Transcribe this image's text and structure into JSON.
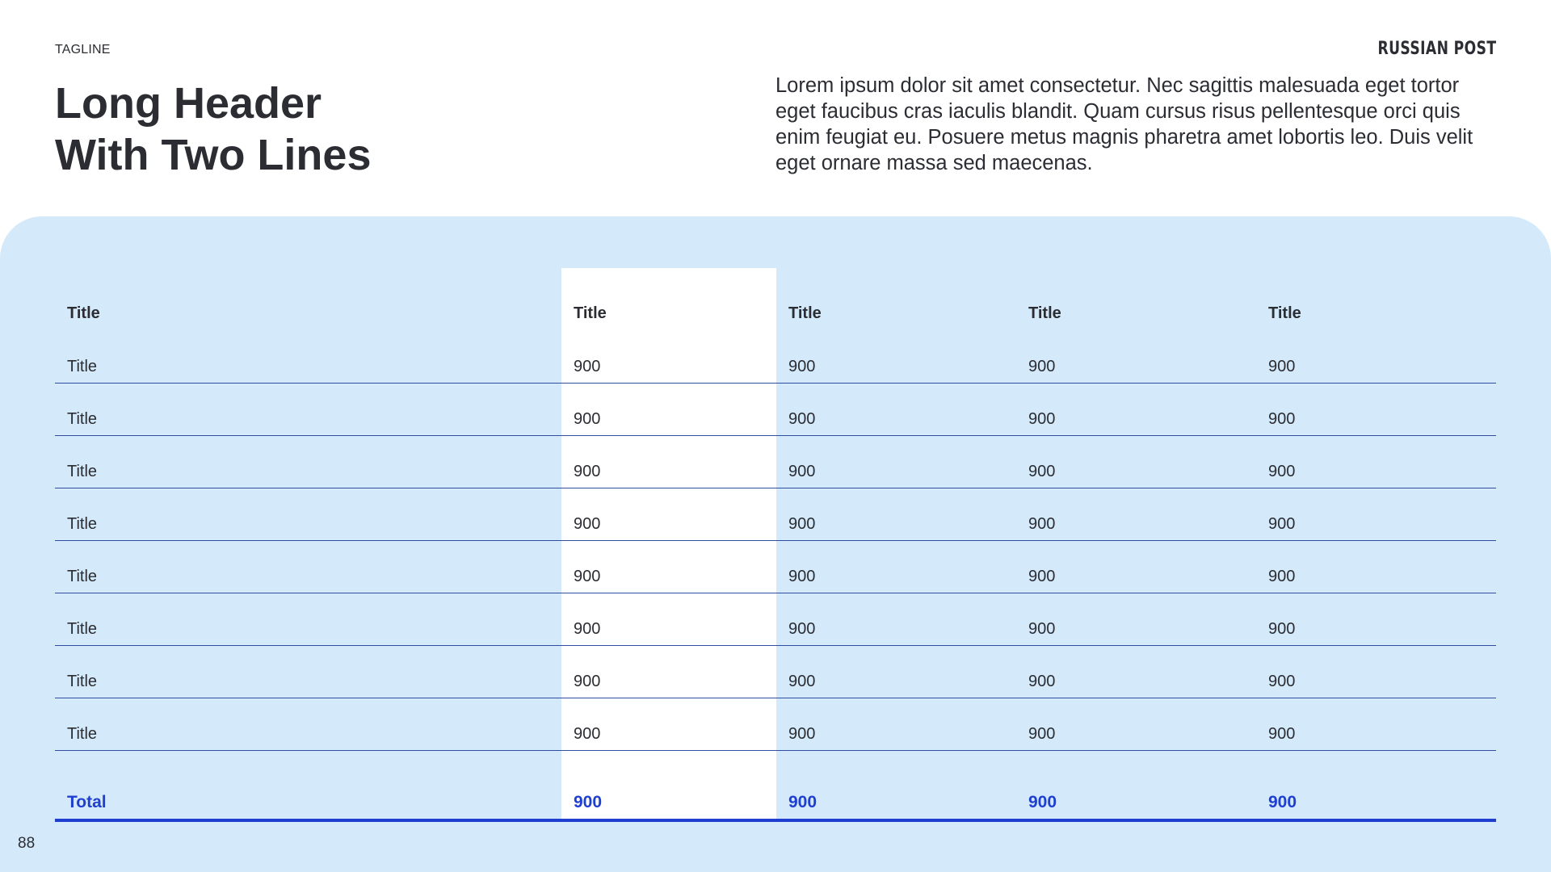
{
  "header": {
    "tagline": "TAGLINE",
    "brand": "RUSSIAN POST",
    "title_line1": "Long Header",
    "title_line2": "With Two Lines",
    "intro": "Lorem ipsum dolor sit amet consectetur. Nec sagittis malesuada eget tortor eget faucibus cras iaculis blandit. Quam cursus risus pellentesque orci quis enim feugiat eu. Posuere metus magnis pharetra amet lobortis leo. Duis velit eget ornare massa sed maecenas."
  },
  "colors": {
    "panel_background": "#d4eafb",
    "accent": "#1f3fd1",
    "rule": "#2f4f9e",
    "text": "#2b2d33"
  },
  "table": {
    "columns": [
      "Title",
      "Title",
      "Title",
      "Title",
      "Title"
    ],
    "rows": [
      [
        "Title",
        "900",
        "900",
        "900",
        "900"
      ],
      [
        "Title",
        "900",
        "900",
        "900",
        "900"
      ],
      [
        "Title",
        "900",
        "900",
        "900",
        "900"
      ],
      [
        "Title",
        "900",
        "900",
        "900",
        "900"
      ],
      [
        "Title",
        "900",
        "900",
        "900",
        "900"
      ],
      [
        "Title",
        "900",
        "900",
        "900",
        "900"
      ],
      [
        "Title",
        "900",
        "900",
        "900",
        "900"
      ],
      [
        "Title",
        "900",
        "900",
        "900",
        "900"
      ]
    ],
    "total": [
      "Total",
      "900",
      "900",
      "900",
      "900"
    ]
  },
  "footer": {
    "page_number": "88"
  }
}
